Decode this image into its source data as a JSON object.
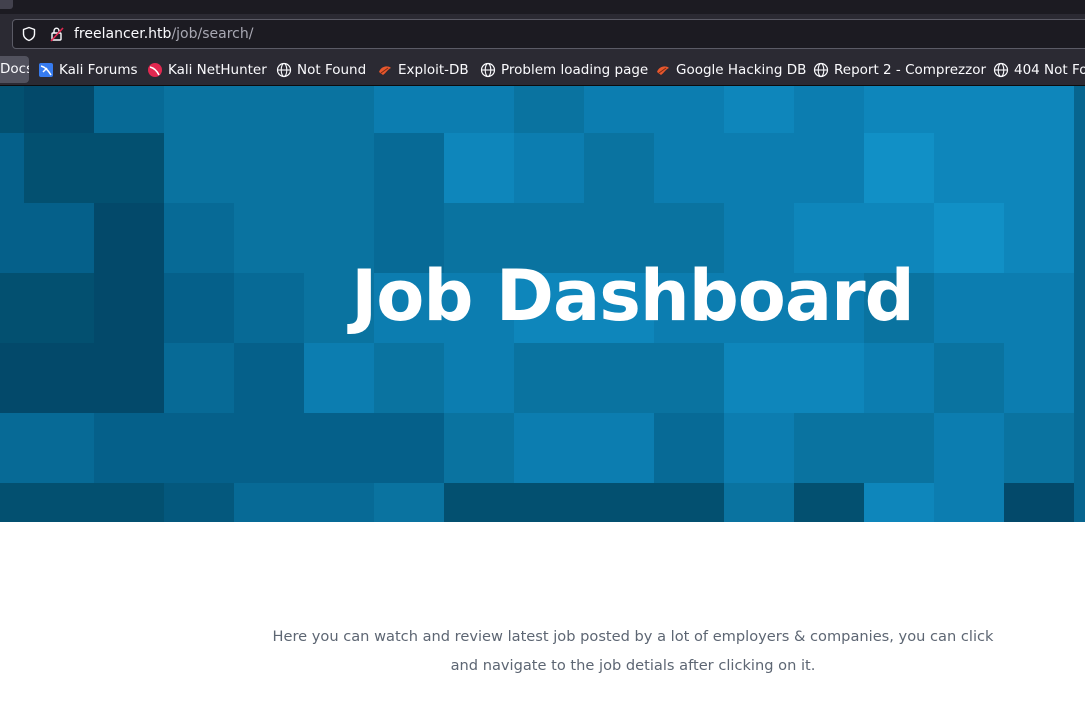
{
  "browser": {
    "url_host": "freelancer.htb",
    "url_path": "/job/search/",
    "bookmarks": [
      {
        "label": "Docs",
        "icon": "docs-icon"
      },
      {
        "label": "Kali Forums",
        "icon": "kali-forums-icon"
      },
      {
        "label": "Kali NetHunter",
        "icon": "kali-nethunter-icon"
      },
      {
        "label": "Not Found",
        "icon": "globe-icon"
      },
      {
        "label": "Exploit-DB",
        "icon": "exploit-db-icon"
      },
      {
        "label": "Problem loading page",
        "icon": "globe-icon"
      },
      {
        "label": "Google Hacking DB",
        "icon": "exploit-db-icon"
      },
      {
        "label": "Report 2 - Comprezzor",
        "icon": "globe-icon"
      },
      {
        "label": "404 Not Fo",
        "icon": "globe-icon"
      }
    ]
  },
  "hero": {
    "title": "Job Dashboard",
    "background_color": "#07658f"
  },
  "intro": {
    "text": "Here you can watch and review latest job posted by a lot of employers & companies, you can click and navigate to the job detials after clicking on it."
  }
}
